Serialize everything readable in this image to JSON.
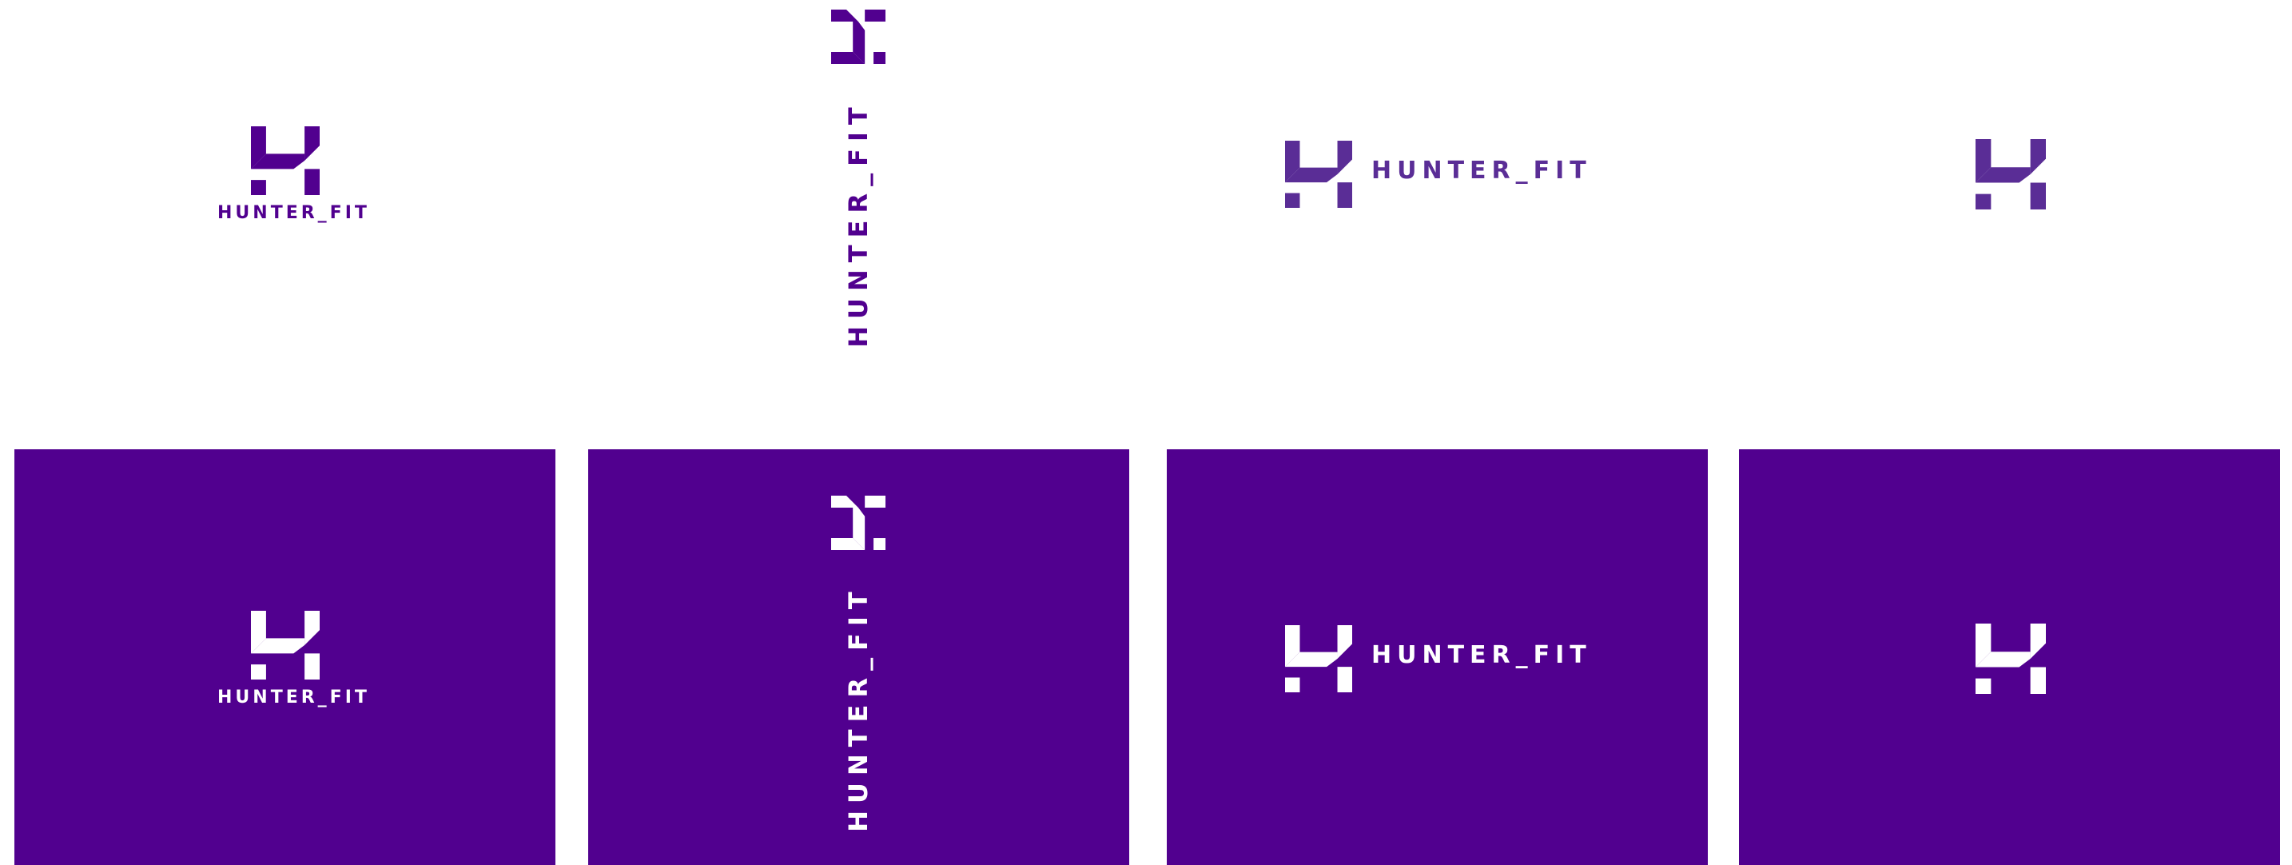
{
  "brand": {
    "wordmark": "HUNTER_FIT",
    "primary_color": "#51008f",
    "light_variant_color": "#5a2d96",
    "on_dark_color": "#ffffff",
    "icon": "h-monogram-icon"
  },
  "variants": [
    {
      "layout": "stacked",
      "background": "light",
      "wordmark": "HUNTER_FIT"
    },
    {
      "layout": "vertical",
      "background": "light",
      "wordmark": "HUNTER_FIT"
    },
    {
      "layout": "horizontal",
      "background": "light",
      "wordmark": "HUNTER_FIT"
    },
    {
      "layout": "icon-only",
      "background": "light"
    },
    {
      "layout": "stacked",
      "background": "dark",
      "wordmark": "HUNTER_FIT"
    },
    {
      "layout": "vertical",
      "background": "dark",
      "wordmark": "HUNTER_FIT"
    },
    {
      "layout": "horizontal",
      "background": "dark",
      "wordmark": "HUNTER_FIT"
    },
    {
      "layout": "icon-only",
      "background": "dark"
    }
  ]
}
